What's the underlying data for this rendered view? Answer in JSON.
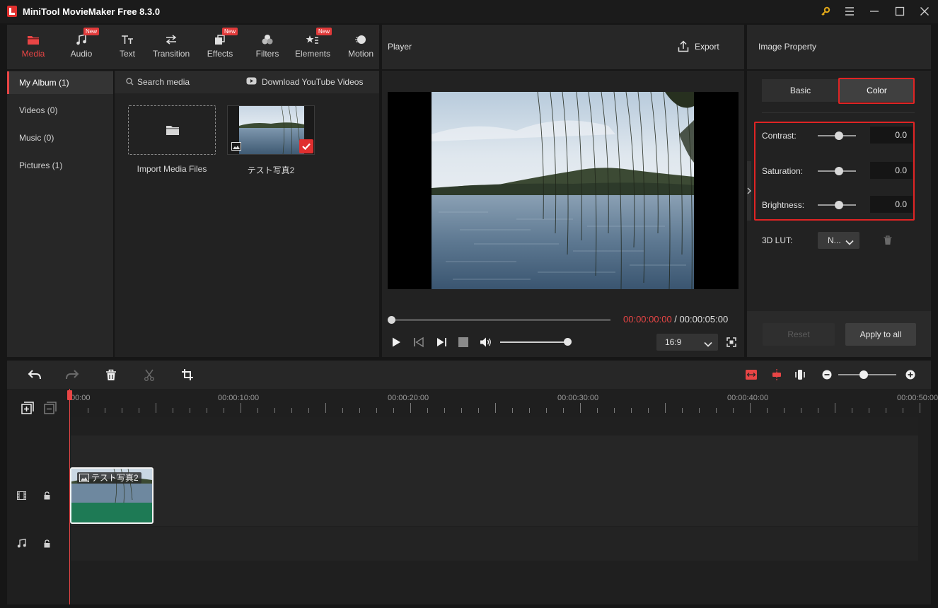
{
  "app": {
    "title": "MiniTool MovieMaker Free 8.3.0"
  },
  "toolbar": {
    "tabs": [
      {
        "label": "Media",
        "icon": "folder-icon",
        "new": false,
        "active": true
      },
      {
        "label": "Audio",
        "icon": "music-note-icon",
        "new": true,
        "active": false
      },
      {
        "label": "Text",
        "icon": "text-icon",
        "new": false,
        "active": false
      },
      {
        "label": "Transition",
        "icon": "transition-arrows-icon",
        "new": false,
        "active": false
      },
      {
        "label": "Effects",
        "icon": "effects-icon",
        "new": true,
        "active": false
      },
      {
        "label": "Filters",
        "icon": "filters-icon",
        "new": false,
        "active": false
      },
      {
        "label": "Elements",
        "icon": "elements-icon",
        "new": true,
        "active": false
      },
      {
        "label": "Motion",
        "icon": "motion-icon",
        "new": false,
        "active": false
      }
    ],
    "new_badge": "New"
  },
  "sidebar": {
    "items": [
      {
        "label": "My Album (1)",
        "active": true
      },
      {
        "label": "Videos (0)",
        "active": false
      },
      {
        "label": "Music (0)",
        "active": false
      },
      {
        "label": "Pictures (1)",
        "active": false
      }
    ]
  },
  "media": {
    "search_placeholder": "Search media",
    "download_label": "Download YouTube Videos",
    "import_label": "Import Media Files",
    "item_label": "テスト写真2"
  },
  "player": {
    "title": "Player",
    "export_label": "Export",
    "time_current": "00:00:00:00",
    "time_sep": " / ",
    "time_total": "00:00:05:00",
    "aspect": "16:9",
    "progress": 0,
    "volume": 1.0
  },
  "property": {
    "title": "Image Property",
    "tab_basic": "Basic",
    "tab_color": "Color",
    "contrast_label": "Contrast:",
    "contrast_value": "0.0",
    "saturation_label": "Saturation:",
    "saturation_value": "0.0",
    "brightness_label": "Brightness:",
    "brightness_value": "0.0",
    "lut_label": "3D LUT:",
    "lut_value": "N...",
    "reset_label": "Reset",
    "apply_label": "Apply to all"
  },
  "timeline": {
    "ticks": [
      "00:00",
      "00:00:10:00",
      "00:00:20:00",
      "00:00:30:00",
      "00:00:40:00",
      "00:00:50:00"
    ],
    "clip_label": "テスト写真2"
  },
  "colors": {
    "accent": "#e84545",
    "highlight_border": "#e02424"
  }
}
